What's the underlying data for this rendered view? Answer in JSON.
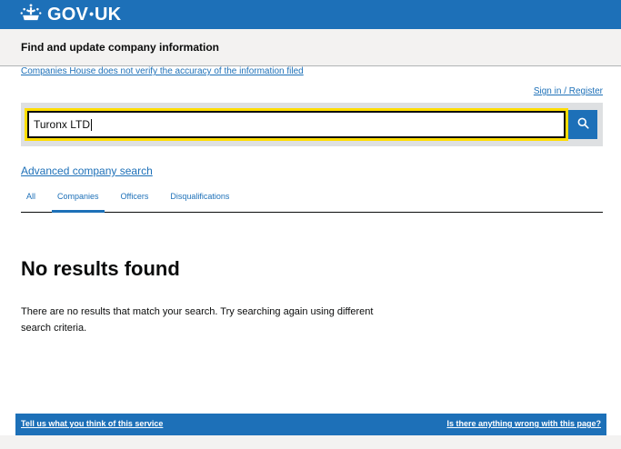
{
  "header": {
    "logo_text": "GOV",
    "logo_suffix": "UK",
    "brand_color": "#1d70b8",
    "logo_icon": "crown-icon"
  },
  "service": {
    "name": "Find and update company information"
  },
  "disclaimer": "Companies House does not verify the accuracy of the information filed",
  "account": {
    "sign_in_label": "Sign in / Register"
  },
  "search": {
    "value": "Turonx LTD",
    "button_icon": "search-icon",
    "focus_color": "#ffdd00"
  },
  "advanced_search_label": "Advanced company search",
  "tabs": [
    {
      "label": "All",
      "active": false
    },
    {
      "label": "Companies",
      "active": true
    },
    {
      "label": "Officers",
      "active": false
    },
    {
      "label": "Disqualifications",
      "active": false
    }
  ],
  "results": {
    "heading": "No results found",
    "message": "There are no results that match your search. Try searching again using different search criteria."
  },
  "footer": {
    "feedback_label": "Tell us what you think of this service",
    "report_label": "Is there anything wrong with this page?"
  }
}
